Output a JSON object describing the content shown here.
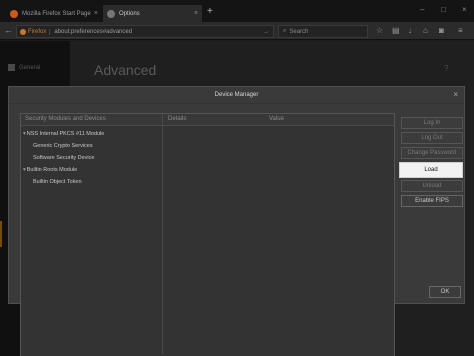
{
  "tabs": [
    {
      "title": "Mozilla Firefox Start Page",
      "favicon": "firefox-icon",
      "color": "#d05a12"
    },
    {
      "title": "Options",
      "favicon": "gear-icon",
      "color": "#888888"
    }
  ],
  "nav": {
    "brand": "Firefox",
    "url": "about:preferences#advanced",
    "search_placeholder": "Search"
  },
  "sidebar": {
    "items": [
      {
        "label": "General"
      }
    ]
  },
  "page": {
    "title": "Advanced"
  },
  "dialog": {
    "title": "Device Manager",
    "columns": {
      "modules": "Security Modules and Devices",
      "details": "Details",
      "value": "Value"
    },
    "tree": [
      {
        "label": "NSS Internal PKCS #11 Module",
        "level": 0
      },
      {
        "label": "Generic Crypto Services",
        "level": 1
      },
      {
        "label": "Software Security Device",
        "level": 1
      },
      {
        "label": "Builtin Roots Module",
        "level": 0
      },
      {
        "label": "Builtin Object Token",
        "level": 1
      }
    ],
    "buttons": [
      {
        "label": "Log In",
        "state": "disabled"
      },
      {
        "label": "Log Out",
        "state": "disabled"
      },
      {
        "label": "Change Password",
        "state": "disabled"
      },
      {
        "label": "Load",
        "state": "focused"
      },
      {
        "label": "Unload",
        "state": "disabled"
      },
      {
        "label": "Enable FIPS",
        "state": "enabled"
      }
    ],
    "ok_label": "OK"
  },
  "colors": {
    "accent": "#c77b22",
    "dialog_bg": "#3a3a3a",
    "focused_button_bg": "#f2f2f2"
  }
}
